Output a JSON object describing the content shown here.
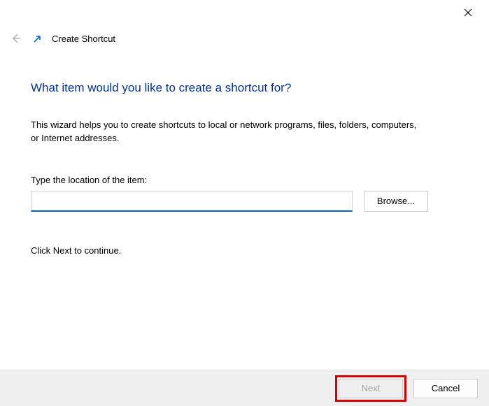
{
  "titlebar": {
    "close_label": "✕"
  },
  "header": {
    "window_title": "Create Shortcut"
  },
  "content": {
    "heading": "What item would you like to create a shortcut for?",
    "description": "This wizard helps you to create shortcuts to local or network programs, files, folders, computers, or Internet addresses.",
    "input_label": "Type the location of the item:",
    "location_value": "",
    "browse_label": "Browse...",
    "continue_text": "Click Next to continue."
  },
  "footer": {
    "next_label": "Next",
    "cancel_label": "Cancel"
  }
}
